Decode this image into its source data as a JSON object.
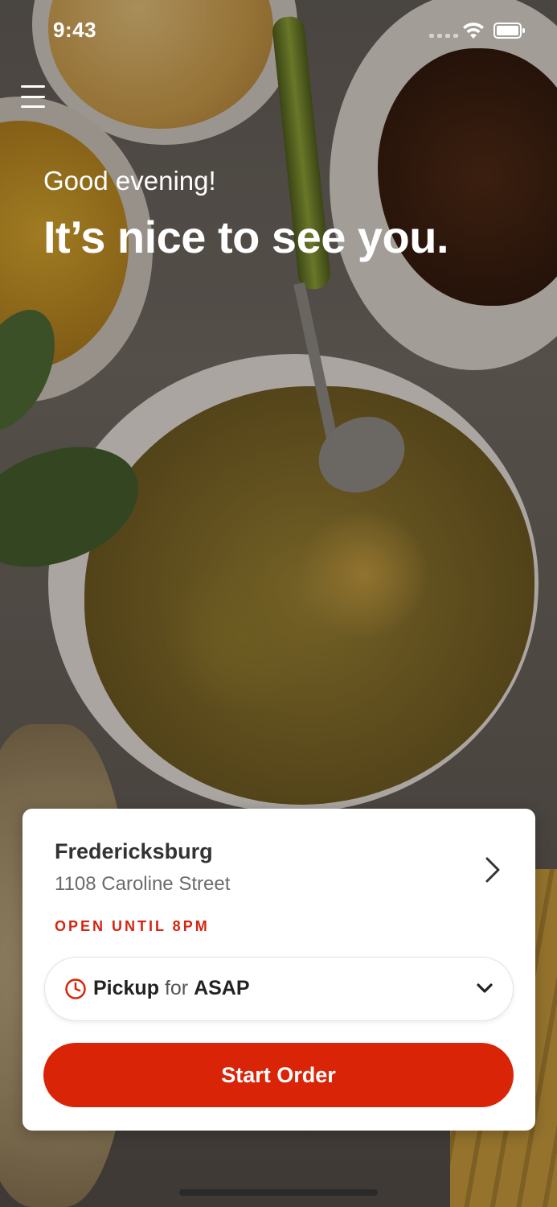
{
  "status_bar": {
    "time": "9:43",
    "wifi_icon": "wifi-icon",
    "battery_icon": "battery-icon",
    "signal_icon": "signal-dots-icon"
  },
  "header": {
    "menu_icon": "hamburger-menu-icon",
    "greeting": "Good evening!",
    "headline": "It’s nice to see you."
  },
  "location": {
    "name": "Fredericksburg",
    "address": "1108 Caroline Street",
    "hours": "OPEN UNTIL 8PM",
    "chevron_icon": "chevron-right-icon"
  },
  "order_mode": {
    "method": "Pickup",
    "connector": "for",
    "time": "ASAP",
    "clock_icon": "clock-icon",
    "dropdown_icon": "chevron-down-icon"
  },
  "cta": {
    "label": "Start Order"
  },
  "colors": {
    "accent": "#d92408",
    "hours_text": "#d62411",
    "card_bg": "#ffffff"
  }
}
